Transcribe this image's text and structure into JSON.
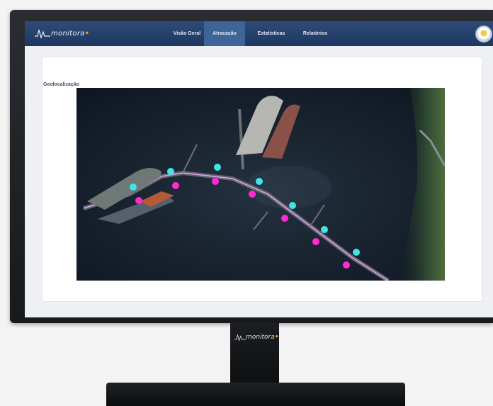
{
  "app": {
    "logo_text": "monitora",
    "logo_prefix": "/\\",
    "logo_accent": "•",
    "brand_color": "#1d3760",
    "accent_color": "#f0a21e"
  },
  "nav": {
    "items": [
      {
        "label": "Visão Geral"
      },
      {
        "label": "Atracação"
      },
      {
        "label": "Estatísticas"
      },
      {
        "label": "Relatórios"
      }
    ],
    "active_index": 1
  },
  "page": {
    "section_title": "Geolocalização"
  },
  "map": {
    "sensor_colors": {
      "cyan": "#3fe6e6",
      "magenta": "#ff2bd6"
    },
    "cyan_sensor_count": 7,
    "magenta_sensor_count": 7
  },
  "stand": {
    "logo_text": "monitora"
  }
}
